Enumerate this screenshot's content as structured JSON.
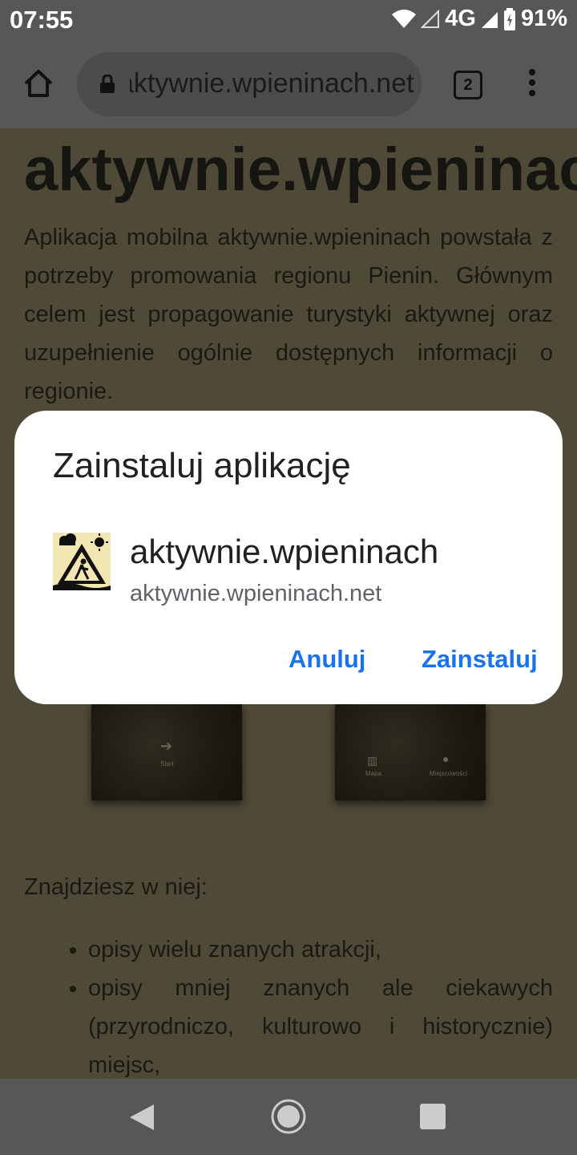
{
  "status_bar": {
    "time": "07:55",
    "network": "4G",
    "battery": "91%"
  },
  "browser": {
    "url": "aktywnie.wpieninach.net",
    "tab_count": "2"
  },
  "page": {
    "title": "aktywnie.wpieninach",
    "intro": "Aplikacja mobilna aktywnie.wpieninach powstała z potrzeby promowania regionu Pienin. Głównym celem jest propagowanie turystyki aktywnej oraz uzupełnienie ogólnie dostępnych informacji o regionie.",
    "screenshots": [
      {
        "labels": [
          "Start"
        ]
      },
      {
        "labels": [
          "Mapa",
          "Miejscowości"
        ]
      }
    ],
    "find_heading": "Znajdziesz w niej:",
    "list": [
      "opisy wielu znanych atrakcji,",
      "opisy mniej znanych ale ciekawych (przyrodniczo, kulturowo i historycznie) miejsc,"
    ]
  },
  "dialog": {
    "title": "Zainstaluj aplikację",
    "app_name": "aktywnie.wpieninach",
    "app_url": "aktywnie.wpieninach.net",
    "cancel_label": "Anuluj",
    "install_label": "Zainstaluj",
    "accent_color": "#1a73e8"
  },
  "icons": [
    "wifi-icon",
    "signal-icon",
    "battery-icon",
    "home-icon",
    "lock-icon",
    "tabs-icon",
    "more-vert-icon",
    "back-icon",
    "home-nav-icon",
    "recents-icon"
  ]
}
